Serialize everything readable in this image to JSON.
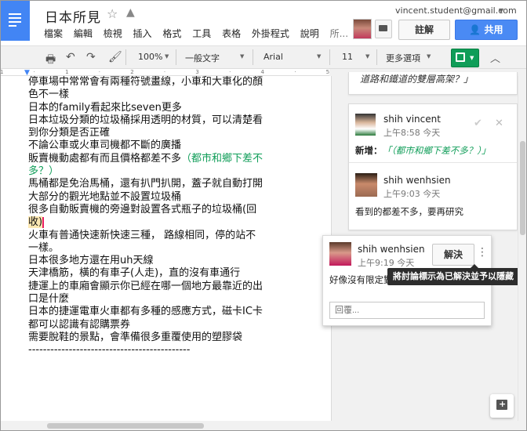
{
  "header": {
    "title": "日本所見",
    "account_email": "vincent.student@gmail.com",
    "menu": [
      "檔案",
      "編輯",
      "檢視",
      "插入",
      "格式",
      "工具",
      "表格",
      "外掛程式",
      "說明",
      "所..."
    ],
    "comment_button": "註解",
    "share_button": "共用"
  },
  "toolbar": {
    "zoom": "100%",
    "style": "一般文字",
    "font": "Arial",
    "font_size": "11",
    "more_options": "更多選項"
  },
  "document": {
    "lines": [
      "停車場中常常會有兩種符號畫線，小車和大車化的顏色不一樣",
      "日本的family看起來比seven更多",
      "日本垃圾分類的垃圾桶採用透明的材質，可以清楚看到你分類是否正確",
      "不論公車或火車司機都不斷的廣播",
      "販賣機動處都有而且價格都差不多",
      "馬桶都是免治馬桶，還有扒門扒開，蓋子就自動打開",
      "大部分的觀光地點並不設置垃圾桶",
      "很多自動販賣機的旁邊對設置各式瓶子的垃圾桶(回",
      "收)",
      "火車有普通快速新快速三種， 路線相同，停的站不一樣。",
      "日本很多地方還在用uh天線",
      "天津橋筋，橫的有車子(人走)，直的沒有車通行",
      "捷運上的車廂會顯示你已經在哪一個地方最靠近的出口是什麼",
      "日本的捷運電車火車都有多種的感應方式，磁卡IC卡都可以認識有認購票券",
      "需要脫鞋的景點，會準備很多重覆使用的塑膠袋",
      "--------------------------------------------"
    ],
    "suggestion_insert": "（都市和鄉下差不多？）"
  },
  "comments": {
    "top_snippet": "道路和鐵道的雙層高架？」",
    "suggestion": {
      "author": "shih vincent",
      "time": "上午8:58 今天",
      "label": "新增：",
      "text": "「（都市和鄉下差不多？）」"
    },
    "reply": {
      "author": "shih wenhsien",
      "time": "上午9:03 今天",
      "text": "看到的都差不多，要再研究"
    },
    "active": {
      "author": "shih wenhsien",
      "time": "上午9:19 今天",
      "text": "好像沒有限定對",
      "resolve_label": "解決",
      "tooltip": "將討論標示為已解決並予以隱藏",
      "reply_placeholder": "回覆..."
    }
  }
}
